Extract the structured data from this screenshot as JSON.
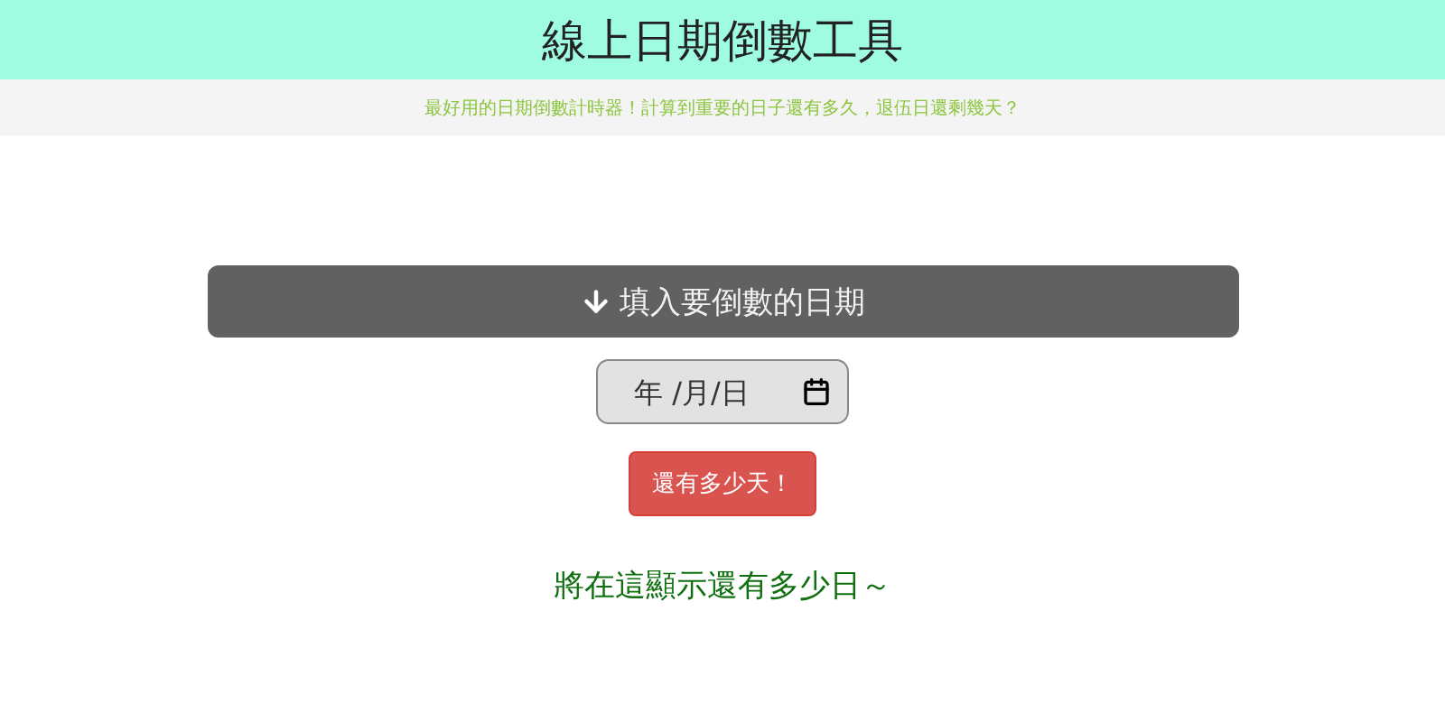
{
  "header": {
    "title": "線上日期倒數工具"
  },
  "subtitle": "最好用的日期倒數計時器！計算到重要的日子還有多久，退伍日還剩幾天？",
  "date_section": {
    "heading": "填入要倒數的日期",
    "date_field": {
      "placeholder": "年 /月/日"
    },
    "button": "還有多少天！"
  },
  "result": "將在這顯示還有多少日～"
}
